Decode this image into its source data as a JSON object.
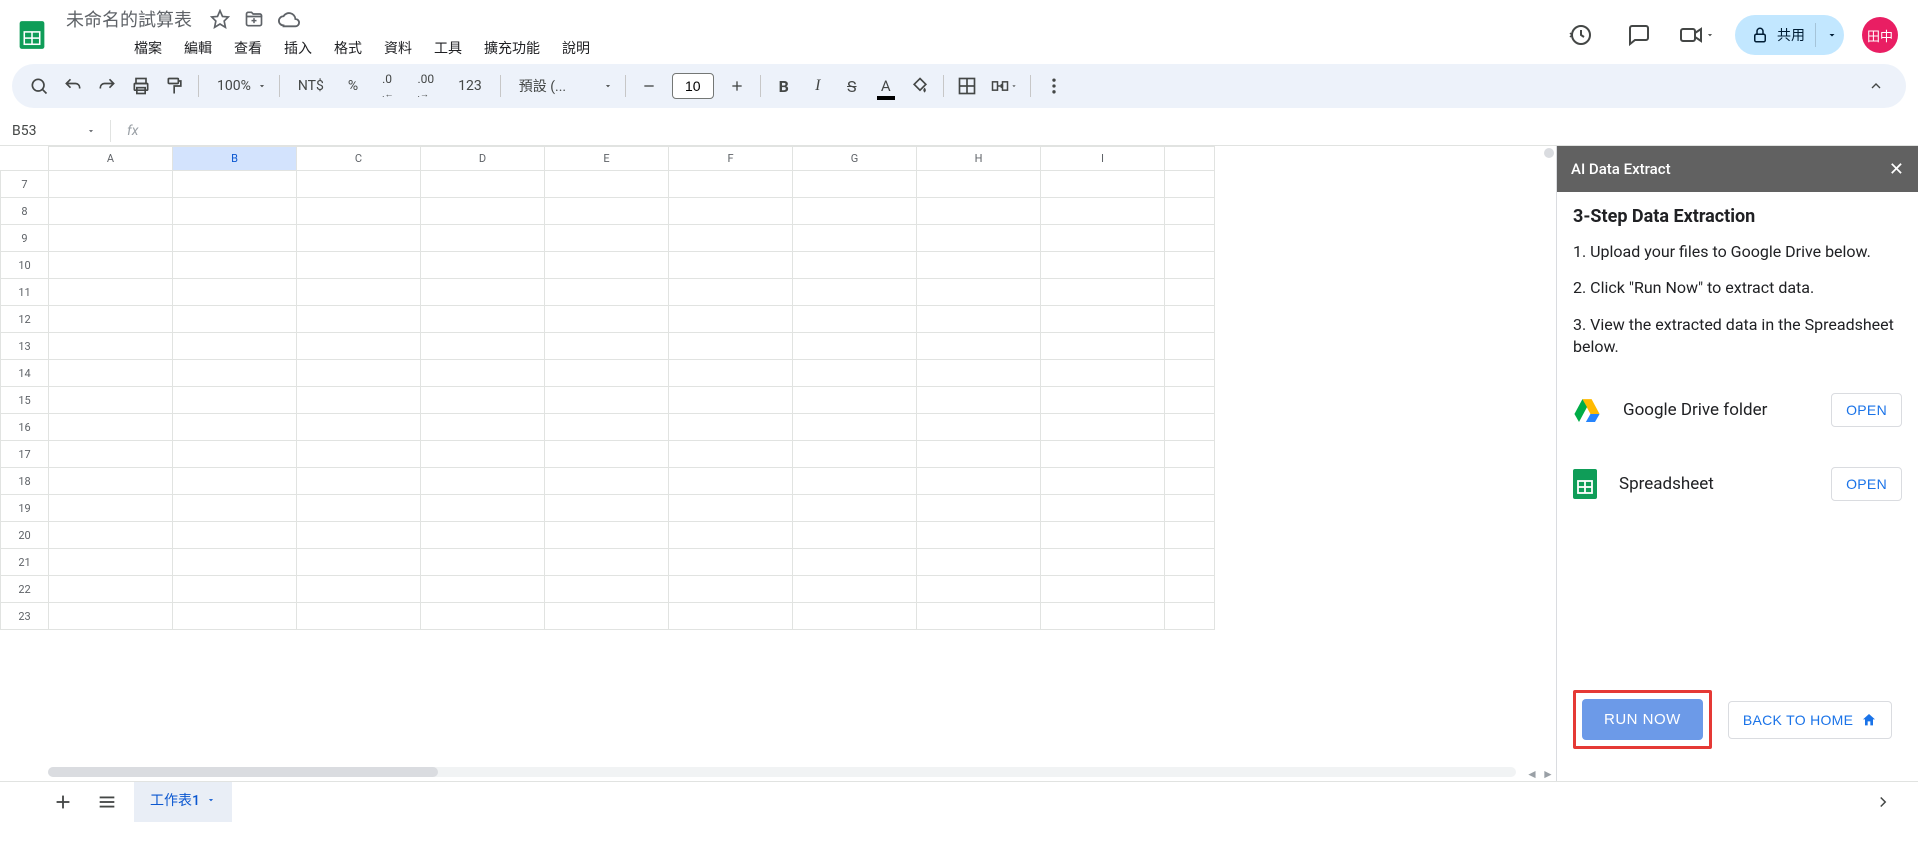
{
  "header": {
    "doc_title": "未命名的試算表",
    "share_label": "共用",
    "avatar_text": "田中"
  },
  "menubar": [
    "檔案",
    "編輯",
    "查看",
    "插入",
    "格式",
    "資料",
    "工具",
    "擴充功能",
    "說明"
  ],
  "toolbar": {
    "zoom": "100%",
    "currency": "NT$",
    "percent": "%",
    "dec_dec": ".0",
    "inc_dec": ".00",
    "num_fmt": "123",
    "font_name": "預設 (...",
    "font_size": "10"
  },
  "formula": {
    "name_box": "B53",
    "fx": "fx"
  },
  "grid": {
    "columns": [
      "A",
      "B",
      "C",
      "D",
      "E",
      "F",
      "G",
      "H",
      "I"
    ],
    "selected_col": "B",
    "row_start": 7,
    "row_end": 23
  },
  "tabs": {
    "sheet1": "工作表1"
  },
  "sidepanel": {
    "title": "AI Data Extract",
    "heading": "3-Step Data Extraction",
    "step1": "1. Upload your files to Google Drive below.",
    "step2": "2. Click \"Run Now\" to extract data.",
    "step3": "3. View the extracted data in the Spreadsheet below.",
    "drive_label": "Google Drive folder",
    "sheet_label": "Spreadsheet",
    "open": "OPEN",
    "run": "RUN NOW",
    "back": "BACK TO HOME"
  }
}
